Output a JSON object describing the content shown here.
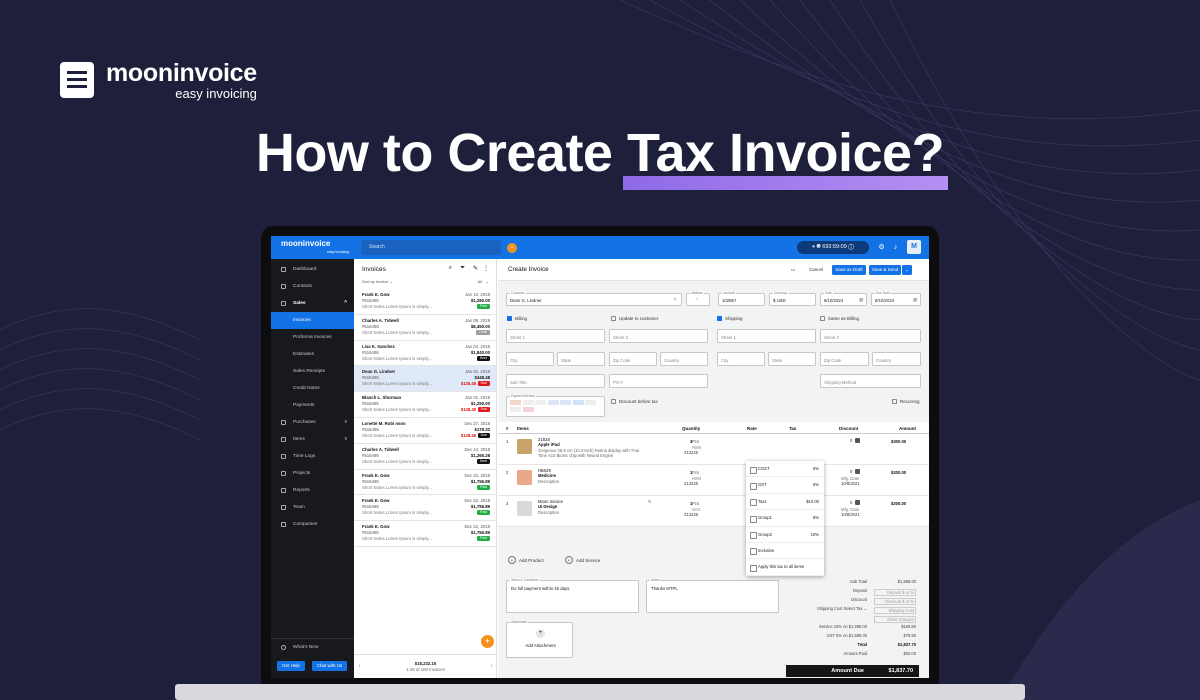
{
  "brand": {
    "name": "mooninvoice",
    "tagline": "easy invoicing"
  },
  "headline": {
    "prefix": "How to Create ",
    "highlight": "Tax Invoice?"
  },
  "colors": {
    "page_bg": "#1e1f3b",
    "accent": "#1373e6",
    "highlight": "#9b78ec",
    "orange": "#f5921e",
    "paid": "#1fae44",
    "due": "#e01818",
    "sent": "#111111"
  },
  "app": {
    "logo": "mooninvoice",
    "logo_tag": "easy invoicing",
    "search_placeholder": "Search",
    "timer": "693:59:09",
    "avatar": "M"
  },
  "sidebar": {
    "items": [
      {
        "label": "Dashboard",
        "icon": "dashboard-icon"
      },
      {
        "label": "Contacts",
        "icon": "contacts-icon"
      },
      {
        "label": "Sales",
        "icon": "sales-icon",
        "chev": "^",
        "bold": true
      },
      {
        "label": "Invoices",
        "sub": true,
        "active": true
      },
      {
        "label": "Proforma Invoices",
        "sub": true
      },
      {
        "label": "Estimates",
        "sub": true
      },
      {
        "label": "Sales Receipts",
        "sub": true
      },
      {
        "label": "Credit Notes",
        "sub": true
      },
      {
        "label": "Payments",
        "sub": true
      },
      {
        "label": "Purchases",
        "icon": "purchases-icon",
        "chev": "v"
      },
      {
        "label": "Items",
        "icon": "items-icon",
        "chev": "v"
      },
      {
        "label": "Time Logs",
        "icon": "time-icon"
      },
      {
        "label": "Projects",
        "icon": "projects-icon"
      },
      {
        "label": "Reports",
        "icon": "reports-icon"
      },
      {
        "label": "Team",
        "icon": "team-icon"
      },
      {
        "label": "Companies",
        "icon": "companies-icon"
      }
    ],
    "whats_new": "What's New",
    "get_help": "Get Help",
    "chat": "Chat with Us"
  },
  "list": {
    "title": "Invoices",
    "sort": "Sort by Invoice",
    "filter": "All",
    "invoices": [
      {
        "name": "Frank E. Gow",
        "no": "#516495",
        "date": "Jan 10, 2019",
        "amount": "$1,280.00",
        "note": "Short Notes Lorem Ipsum is simply...",
        "status": "Paid",
        "color": "#1fae44"
      },
      {
        "name": "Charles A. Tidwell",
        "no": "#516495",
        "date": "Jan 08, 2019",
        "amount": "$8,450.00",
        "note": "Short Notes Lorem Ipsum is simply...",
        "status": "Draft",
        "color": "#9a9a9a"
      },
      {
        "name": "Lisa K. Sanchez",
        "no": "#516495",
        "date": "Jan 04, 2019",
        "amount": "$1,840.00",
        "note": "Short Notes Lorem Ipsum is simply...",
        "status": "Sent",
        "color": "#111111"
      },
      {
        "name": "Dean G. Lindner",
        "no": "#516495",
        "date": "Jan 02, 2019",
        "amount": "$348.48",
        "note": "Short Notes Lorem Ipsum is simply...",
        "status": "Due",
        "color": "#e01818",
        "due": "$128.48",
        "sel": true
      },
      {
        "name": "Blanch L. Shurman",
        "no": "#516495",
        "date": "Jan 01, 2019",
        "amount": "$1,250.00",
        "note": "Short Notes Lorem Ipsum is simply...",
        "status": "Due",
        "color": "#e01818",
        "due": "$128.48"
      },
      {
        "name": "Lonette M. Robi nson",
        "no": "#516495",
        "date": "Dec 27, 2018",
        "amount": "$178.32",
        "note": "Short Notes Lorem Ipsum is simply...",
        "status": "Due",
        "color": "#111111",
        "due": "$128.48"
      },
      {
        "name": "Charles A. Tidwell",
        "no": "#516495",
        "date": "Dec 24, 2018",
        "amount": "$1,265.28",
        "note": "Short Notes Lorem Ipsum is simply...",
        "status": "Sent",
        "color": "#111111"
      },
      {
        "name": "Frank E. Gow",
        "no": "#516495",
        "date": "Dec 22, 2018",
        "amount": "$1,756.89",
        "note": "Short Notes Lorem Ipsum is simply...",
        "status": "Paid",
        "color": "#1fae44"
      },
      {
        "name": "Frank E. Gow",
        "no": "#516495",
        "date": "Dec 22, 2018",
        "amount": "$1,756.89",
        "note": "Short Notes Lorem Ipsum is simply...",
        "status": "Paid",
        "color": "#1fae44"
      },
      {
        "name": "Frank E. Gow",
        "no": "#516495",
        "date": "Dec 22, 2018",
        "amount": "$1,756.89",
        "note": "Short Notes Lorem Ipsum is simply...",
        "status": "Paid",
        "color": "#1fae44"
      }
    ],
    "footer_total": "$18,232.15",
    "footer_count": "1-25 of 100 Invoices"
  },
  "main": {
    "title": "Create Invoice",
    "cancel": "Cancel",
    "save_draft": "Save as Draft",
    "save_send": "Save & Send",
    "customer_label": "Customer",
    "customer": "Dean G. Lindner",
    "attribute_label": "Attribute",
    "invoice_label": "Invoice#",
    "invoice_no": "102857",
    "currency_label": "Currency",
    "currency": "$ USD",
    "date_label": "Date",
    "date": "8/10/2024",
    "due_label": "Due Date",
    "due": "8/10/2024",
    "billing": "Billing",
    "update_customer": "Update to customer",
    "shipping": "Shipping",
    "same_billing": "Same as Billing",
    "street1": "Street 1",
    "street2": "Street 2",
    "city": "City",
    "state": "State",
    "zip": "Zip Code",
    "country": "Country",
    "subtitle": "Sub Title",
    "po": "PO #",
    "shipping_method": "Shipping Method",
    "payment_method": "Payment Method",
    "discount_before_tax": "Discount before tax",
    "recurring": "Recurring",
    "cols": {
      "no": "#",
      "items": "Items",
      "qty": "Quantity",
      "rate": "Rate",
      "tax": "Tax",
      "discount": "Discount",
      "amount": "Amount"
    },
    "rows": [
      {
        "n": "1",
        "code": "2182S",
        "name": "Apple iPad",
        "desc": "Gorgeous 26.9 cm (10.2-inch) Retina display with True Tone A10 Bionic chip with Neural Engine",
        "qty": "3",
        "unit": "Pcs",
        "hsn": "HSN",
        "hsn_code": "213225",
        "discount": "0",
        "amount": "$300.00"
      },
      {
        "n": "2",
        "code": "HB029",
        "name": "Medicine",
        "desc": "Description",
        "qty": "1",
        "unit": "Pcs",
        "hsn": "HSN",
        "hsn_code": "213225",
        "discount": "0",
        "mfg": "Mfg. Date",
        "mfg_date": "10/8/2021",
        "amount": "$200.00"
      },
      {
        "n": "3",
        "code": "Moon Invoice",
        "name": "UI Design",
        "desc": "Description",
        "qty": "1",
        "unit": "Pcs",
        "hsn": "SAC",
        "hsn_code": "213225",
        "discount": "0",
        "mfg": "Mfg. Date",
        "mfg_date": "10/8/2021",
        "amount": "$200.00"
      }
    ],
    "add_product": "Add Product",
    "add_service": "Add Service",
    "terms_label": "Terms & Conditions",
    "terms": "Do full payment within 45 days.",
    "notes_label": "Notes",
    "notes": "Thanks MTPL",
    "attachment_label": "Attachment",
    "add_attachment": "Add Attachment",
    "tax_dropdown": [
      {
        "name": "CGST",
        "pct": "5%"
      },
      {
        "name": "GST",
        "pct": "5%"
      },
      {
        "name": "Tax1",
        "pct": "$10.00"
      },
      {
        "name": "Group1",
        "pct": "8%"
      },
      {
        "name": "Group2",
        "pct": "10%"
      },
      {
        "name": "Inclusive",
        "pct": ""
      },
      {
        "name": "Apply this tax to all items",
        "pct": ""
      }
    ],
    "totals": [
      {
        "k": "Sub Total",
        "v": "$1,598.00",
        "box": false
      },
      {
        "k": "Deposit",
        "v": "Deposit $ or %",
        "box": true
      },
      {
        "k": "Discount",
        "v": "Discount $ or %",
        "box": true
      },
      {
        "k": "Shipping Cost  Select Tax ⌄",
        "v": "Shipping Cost",
        "box": true
      },
      {
        "k": "",
        "v": "Other Charges",
        "box": true
      },
      {
        "k": "Service 10% on $1,598.00",
        "v": "$159.80",
        "box": false
      },
      {
        "k": "GST 5% on $1,598.00",
        "v": "$79.90",
        "box": false
      },
      {
        "k": "Total",
        "v": "$1,837.70",
        "box": false
      },
      {
        "k": "Amount Paid",
        "v": "$00.00",
        "box": false
      }
    ],
    "amount_due_label": "Amount Due",
    "amount_due": "$1,837.70"
  }
}
